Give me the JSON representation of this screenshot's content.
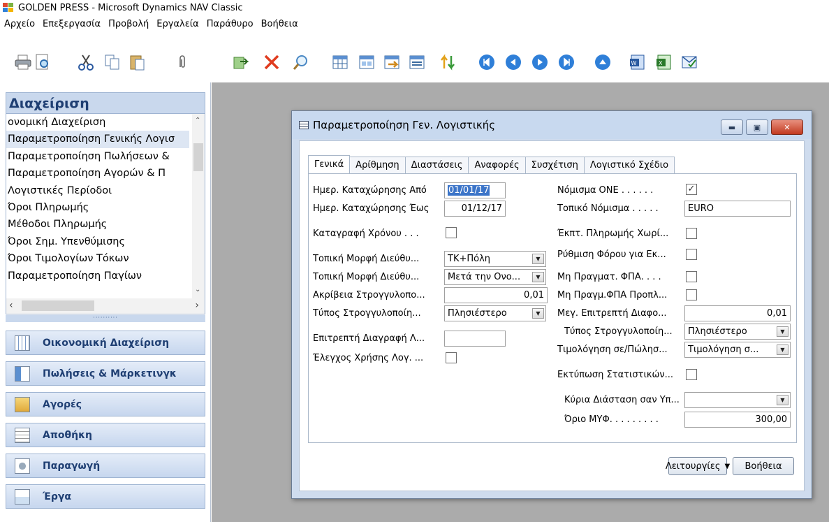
{
  "window": {
    "title": "GOLDEN PRESS - Microsoft Dynamics NAV Classic"
  },
  "menu": [
    "Αρχείο",
    "Επεξεργασία",
    "Προβολή",
    "Εργαλεία",
    "Παράθυρο",
    "Βοήθεια"
  ],
  "toolbar": {
    "icons": [
      "print-icon",
      "print-preview-icon",
      "cut-icon",
      "copy-icon",
      "paste-icon",
      "attach-icon",
      "post-icon",
      "delete-icon",
      "find-icon",
      "table-icon",
      "form-icon",
      "export-icon",
      "list-icon",
      "sort-icon",
      "first-record-icon",
      "previous-record-icon",
      "next-record-icon",
      "last-record-icon",
      "up-icon",
      "word-icon",
      "excel-icon",
      "outlook-icon"
    ]
  },
  "nav": {
    "header": "Διαχείριση",
    "items": [
      "ονομική Διαχείριση",
      "Παραμετροποίηση Γενικής Λογισ",
      "Παραμετροποίηση Πωλήσεων &",
      "Παραμετροποίηση Αγορών & Π",
      "Λογιστικές Περίοδοι",
      "Όροι Πληρωμής",
      "Μέθοδοι Πληρωμής",
      "Όροι Σημ. Υπενθύμισης",
      "Όροι Τιμολογίων Τόκων",
      "Παραμετροποίηση Παγίων"
    ],
    "grip": "··········",
    "buttons": [
      "Οικονομική Διαχείριση",
      "Πωλήσεις & Μάρκετινγκ",
      "Αγορές",
      "Αποθήκη",
      "Παραγωγή",
      "Έργα"
    ]
  },
  "dialog": {
    "title": "Παραμετροποίηση Γεν. Λογιστικής",
    "tabs": [
      "Γενικά",
      "Αρίθμηση",
      "Διαστάσεις",
      "Αναφορές",
      "Συσχέτιση",
      "Λογιστικό Σχέδιο"
    ],
    "left": {
      "posting_from_label": "Ημερ. Καταχώρησης Από",
      "posting_from_value": "01/01/17",
      "posting_to_label": "Ημερ. Καταχώρησης Έως",
      "posting_to_value": "01/12/17",
      "register_time_label": "Καταγραφή Χρόνου . . .",
      "local_address_label": "Τοπική Μορφή Διεύθυ...",
      "local_address_value": "ΤΚ+Πόλη",
      "local_contact_label": "Τοπική Μορφή Διεύθυ...",
      "local_contact_value": "Μετά την Ονο...",
      "rounding_precision_label": "Ακρίβεια Στρογγυλοπο...",
      "rounding_precision_value": "0,01",
      "rounding_type_label": "Τύπος Στρογγυλοποίη...",
      "rounding_type_value": "Πλησιέστερο",
      "allow_delete_label": "Επιτρεπτή Διαγραφή Λ...",
      "allow_delete_value": "",
      "check_account_label": "Έλεγχος Χρήσης Λογ. ..."
    },
    "right": {
      "emu_label": "Νόμισμα ONE . . . . . .",
      "emu_checked": "✓",
      "lcy_label": "Τοπικό Νόμισμα . . . . .",
      "lcy_value": "EURO",
      "pmt_disc_label": "Έκπτ. Πληρωμής Χωρί...",
      "adj_tax_label": "Ρύθμιση Φόρου για Εκ...",
      "unrealized_vat_label": "Μη Πραγματ. ΦΠΑ. . . .",
      "prepay_vat_label": "Μη Πραγμ.ΦΠΑ Προπλ...",
      "max_tol_label": "Μεγ. Επιτρεπτή Διαφο...",
      "max_tol_value": "0,01",
      "inv_rounding_label": "Τύπος Στρογγυλοποίη...",
      "inv_rounding_value": "Πλησιέστερο",
      "bill_to_label": "Τιμολόγηση σε/Πώλησ...",
      "bill_to_value": "Τιμολόγηση σ...",
      "print_vat_label": "Εκτύπωση Στατιστικών...",
      "shortcut_dim_label": "Κύρια Διάσταση σαν Υπ...",
      "shortcut_dim_value": "",
      "lcy_limit_label": "Όριο ΜΥΦ. . . . . . . . .",
      "lcy_limit_value": "300,00"
    },
    "functions_button": "Λειτουργίες",
    "help_button": "Βοήθεια"
  }
}
